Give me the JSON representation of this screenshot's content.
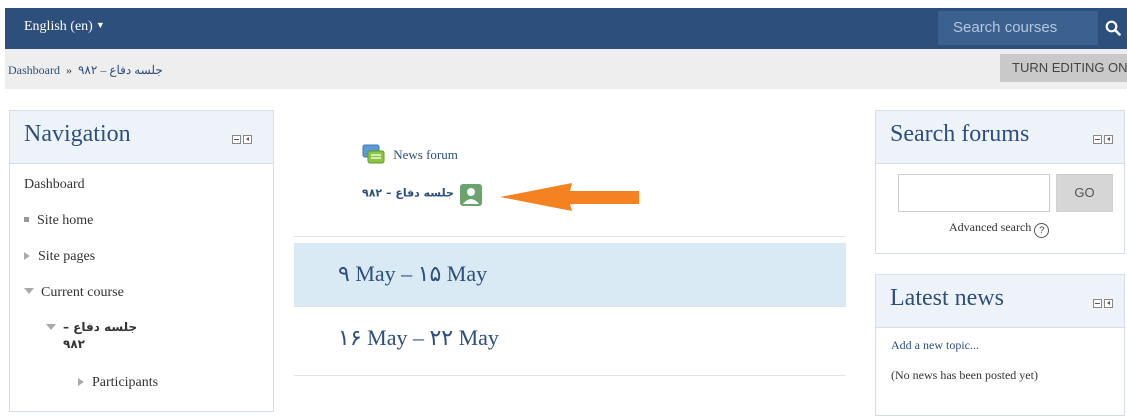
{
  "navbar": {
    "language": "English (en)",
    "search_placeholder": "Search courses"
  },
  "breadcrumb": {
    "items": [
      "Dashboard",
      "جلسه دفاع – ۹۸۲"
    ],
    "separator": "»"
  },
  "editing_button": "TURN EDITING ON",
  "navigation_block": {
    "title": "Navigation",
    "items": {
      "dashboard": "Dashboard",
      "site_home": "Site home",
      "site_pages": "Site pages",
      "current_course": "Current course",
      "course_line1": "جلسه دفاع –",
      "course_line2": "۹۸۲",
      "participants": "Participants"
    }
  },
  "main": {
    "activities": {
      "news_forum": "News forum",
      "course_activity": "جلسه دفاع – ۹۸۲"
    },
    "sections": [
      "۹ May – ۱۵ May",
      "۱۶ May – ۲۲ May"
    ]
  },
  "search_forums_block": {
    "title": "Search forums",
    "go_button": "GO",
    "advanced_search": "Advanced search",
    "help_icon_char": "?"
  },
  "latest_news_block": {
    "title": "Latest news",
    "add_topic": "Add a new topic...",
    "empty_message": "(No news has been posted yet)"
  },
  "colors": {
    "navbar": "#2c4f7c",
    "highlight_section": "#daeaf5",
    "arrow": "#f58220"
  }
}
